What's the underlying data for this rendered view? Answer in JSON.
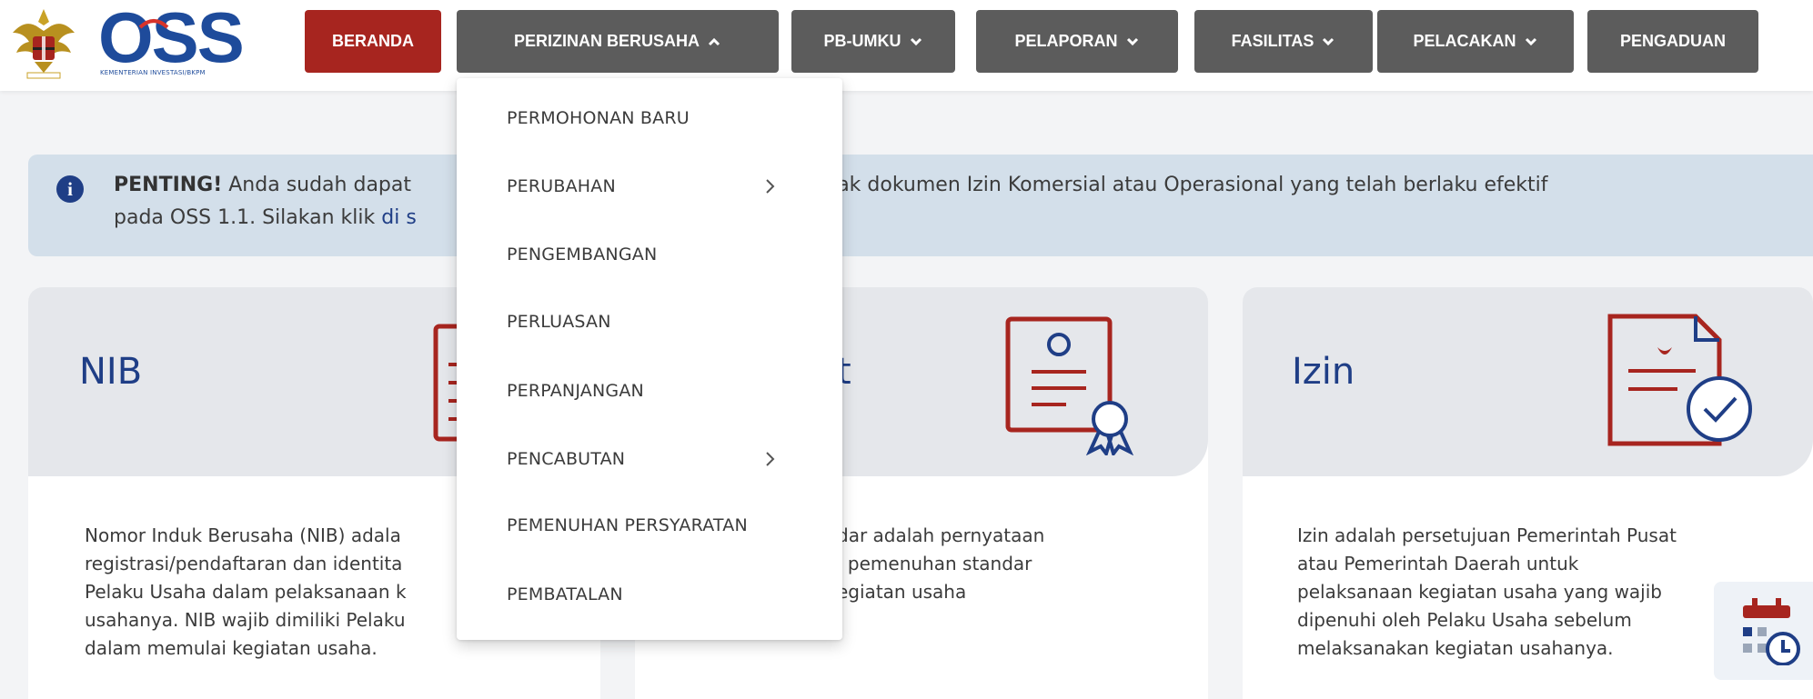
{
  "header": {
    "logo_text": "OSS",
    "logo_subtitle": "KEMENTERIAN INVESTASI/BKPM",
    "nav": {
      "beranda": "BERANDA",
      "perizinan": "PERIZINAN BERUSAHA",
      "pbumku": "PB-UMKU",
      "pelaporan": "PELAPORAN",
      "fasilitas": "FASILITAS",
      "pelacakan": "PELACAKAN",
      "pengaduan": "PENGADUAN"
    }
  },
  "colors": {
    "accent_red": "#a7251f",
    "nav_gray": "#5c5c5c",
    "brand_blue": "#1f3e86",
    "alert_bg": "#d3dfea"
  },
  "dropdown": {
    "items": [
      {
        "label": "PERMOHONAN BARU",
        "submenu": false
      },
      {
        "label": "PERUBAHAN",
        "submenu": true
      },
      {
        "label": "PENGEMBANGAN",
        "submenu": false
      },
      {
        "label": "PERLUASAN",
        "submenu": false
      },
      {
        "label": "PERPANJANGAN",
        "submenu": false
      },
      {
        "label": "PENCABUTAN",
        "submenu": true
      },
      {
        "label": "PEMENUHAN PERSYARATAN",
        "submenu": false
      },
      {
        "label": "PEMBATALAN",
        "submenu": false
      }
    ]
  },
  "alert": {
    "icon": "info-icon",
    "bold": "PENTING!",
    "text_line1_start": " Anda sudah dapat",
    "text_line1_end": "ncetak dokumen Izin Komersial atau Operasional yang telah berlaku efektif",
    "text_line2": "pada OSS 1.1. Silakan klik ",
    "link": "di s"
  },
  "cards": {
    "nib": {
      "title": "NIB",
      "icon": "document-icon",
      "body": [
        "Nomor Induk Berusaha (NIB) adala",
        "registrasi/pendaftaran dan identita",
        "Pelaku Usaha dalam pelaksanaan k",
        "usahanya. NIB wajib dimiliki Pelaku",
        "dalam memulai kegiatan usaha."
      ]
    },
    "sertifikat": {
      "title": "t",
      "icon": "certificate-icon",
      "body": [
        "dar adalah pernyataan",
        "i pemenuhan standar",
        "egiatan usaha"
      ]
    },
    "izin": {
      "title": "Izin",
      "icon": "approved-document-icon",
      "body": [
        "Izin adalah persetujuan Pemerintah Pusat",
        "atau Pemerintah Daerah untuk",
        "pelaksanaan kegiatan usaha yang wajib",
        "dipenuhi oleh Pelaku Usaha sebelum",
        "melaksanakan kegiatan usahanya."
      ]
    }
  },
  "widget": {
    "icon": "calendar-clock-icon"
  }
}
